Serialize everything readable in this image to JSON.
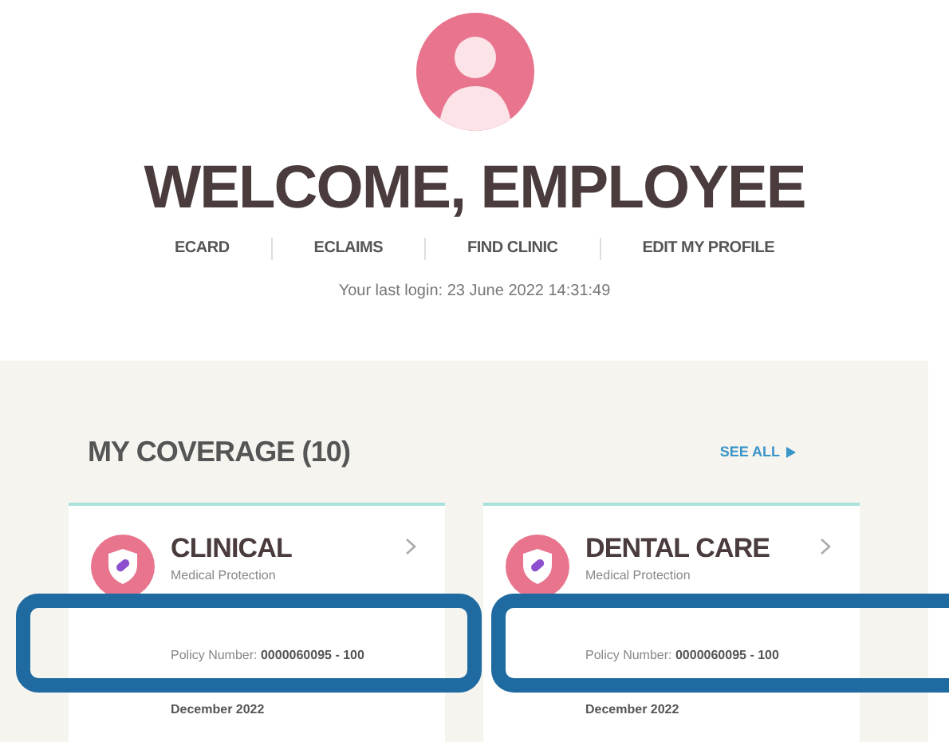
{
  "header": {
    "title": "WELCOME, EMPLOYEE",
    "last_login": "Your last login: 23 June 2022 14:31:49"
  },
  "nav": [
    "ECARD",
    "ECLAIMS",
    "FIND CLINIC",
    "EDIT MY PROFILE"
  ],
  "coverage": {
    "heading": "MY COVERAGE (10)",
    "see_all": "SEE ALL",
    "cards": [
      {
        "title": "CLINICAL",
        "subtitle": "Medical Protection",
        "policy_label": "Policy Number:",
        "policy_number": "0000060095 - 100",
        "expiry": "December 2022",
        "highlighted": true
      },
      {
        "title": "DENTAL CARE",
        "subtitle": "Medical Protection",
        "policy_label": "Policy Number:",
        "policy_number": "0000060095 - 100",
        "expiry": "December 2022",
        "highlighted": true
      }
    ]
  }
}
